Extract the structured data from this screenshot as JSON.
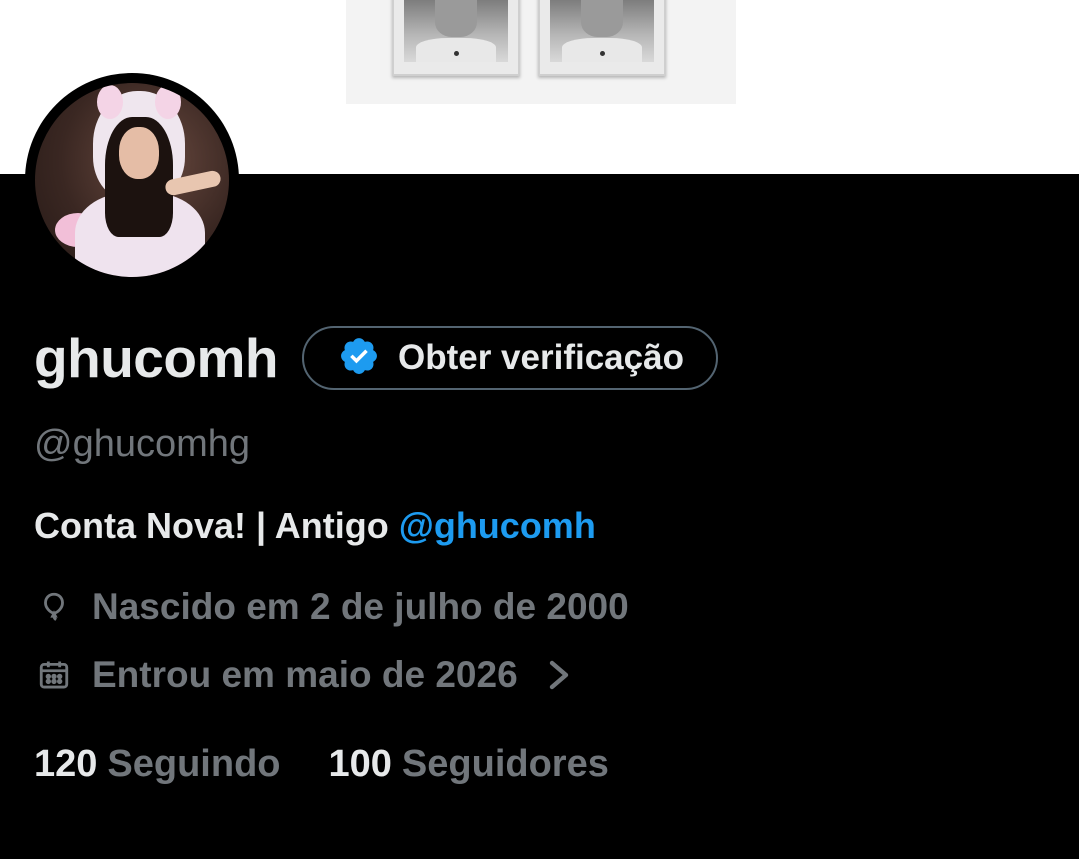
{
  "profile": {
    "display_name": "ghucomh",
    "verify_button": "Obter verificação",
    "handle": "@ghucomhg",
    "bio_text": "Conta Nova! | Antigo ",
    "bio_mention": "@ghucomh",
    "birthday": "Nascido em 2 de julho de 2000",
    "joined": "Entrou em maio de 2026",
    "following_count": "120",
    "following_label": "Seguindo",
    "followers_count": "100",
    "followers_label": "Seguidores"
  },
  "icons": {
    "verified": "verified-badge-icon",
    "birthday": "balloon-icon",
    "joined": "calendar-icon",
    "chevron": "chevron-right-icon"
  },
  "colors": {
    "background": "#000000",
    "primary_text": "#e7e9ea",
    "secondary_text": "#71767b",
    "accent": "#1d9bf0",
    "pill_border": "#536471"
  }
}
